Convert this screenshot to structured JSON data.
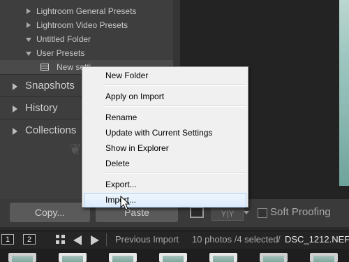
{
  "left_panel": {
    "presets": [
      {
        "label": "Lightroom General Presets",
        "expanded": false
      },
      {
        "label": "Lightroom Video Presets",
        "expanded": false
      },
      {
        "label": "Untitled Folder",
        "expanded": true
      },
      {
        "label": "User Presets",
        "expanded": true
      },
      {
        "label": "New setti",
        "type": "preset-item"
      }
    ],
    "sections": [
      "Snapshots",
      "History",
      "Collections"
    ]
  },
  "buttons": {
    "copy": "Copy...",
    "paste": "Paste"
  },
  "toolbar": {
    "yy_label": "Y|Y",
    "soft_proofing": "Soft Proofing",
    "soft_proofing_checked": false
  },
  "filmstrip": {
    "screen1": "1",
    "screen2": "2",
    "source": "Previous Import",
    "count": "10 photos /4 selected",
    "slash": "/",
    "file": "DSC_1212.NEF"
  },
  "context_menu": {
    "items": [
      "New Folder",
      "Apply on Import",
      "Rename",
      "Update with Current Settings",
      "Show in Explorer",
      "Delete",
      "Export...",
      "Import..."
    ],
    "hovered": "Import..."
  },
  "colors": {
    "panel_bg": "#3e3e3e",
    "menu_bg": "#f0f0f0",
    "menu_hover": "#dcebfc"
  }
}
